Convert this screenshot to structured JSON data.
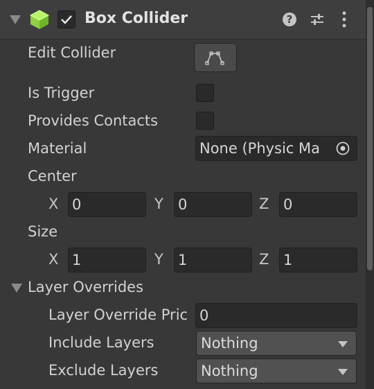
{
  "component": {
    "title": "Box Collider",
    "enabled": true,
    "icons": [
      "collapse-arrow-icon",
      "box-collider-icon",
      "help-icon",
      "presets-icon",
      "kebab-menu-icon"
    ]
  },
  "fields": {
    "edit_collider": "Edit Collider",
    "is_trigger": "Is Trigger",
    "provides_contacts": "Provides Contacts",
    "material_label": "Material",
    "material_value": "None (Physic Ma",
    "center_label": "Center",
    "size_label": "Size"
  },
  "center": {
    "x_label": "X",
    "x": "0",
    "y_label": "Y",
    "y": "0",
    "z_label": "Z",
    "z": "0"
  },
  "size": {
    "x_label": "X",
    "x": "1",
    "y_label": "Y",
    "y": "1",
    "z_label": "Z",
    "z": "1"
  },
  "layer_overrides": {
    "title": "Layer Overrides",
    "priority_label": "Layer Override Pric",
    "priority_value": "0",
    "include_label": "Include Layers",
    "include_value": "Nothing",
    "exclude_label": "Exclude Layers",
    "exclude_value": "Nothing"
  },
  "colors": {
    "panel": "#383838",
    "header": "#3e3e3e",
    "field": "#2a2a2a",
    "accent_green": "#9be04a"
  }
}
